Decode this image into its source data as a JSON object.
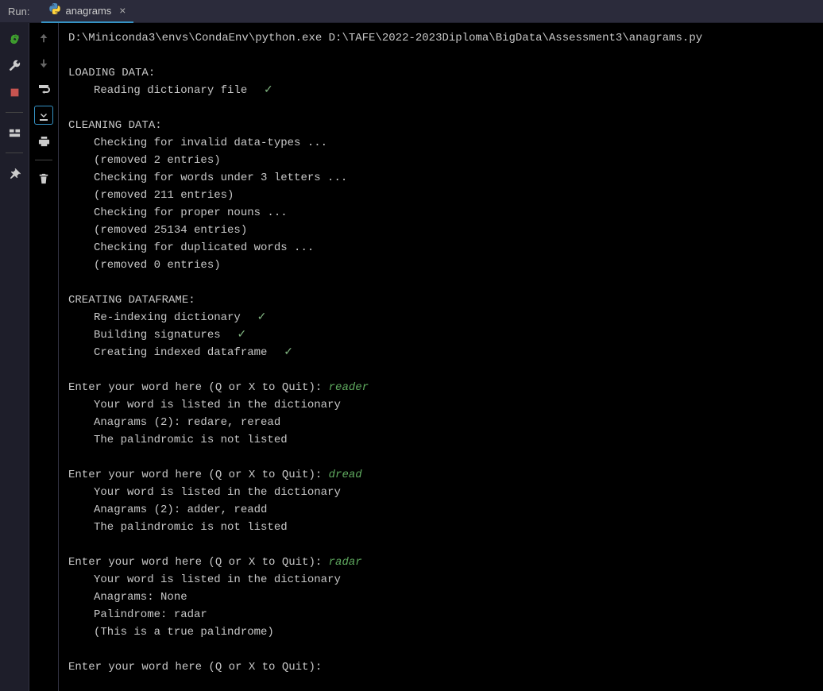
{
  "header": {
    "label": "Run:",
    "tab_name": "anagrams",
    "tab_close": "×"
  },
  "console": {
    "path": "D:\\Miniconda3\\envs\\CondaEnv\\python.exe D:\\TAFE\\2022-2023Diploma\\BigData\\Assessment3\\anagrams.py",
    "sections": [
      {
        "title": "LOADING DATA:",
        "lines": [
          {
            "text": "Reading dictionary file",
            "check": true
          }
        ]
      },
      {
        "title": "CLEANING DATA:",
        "lines": [
          {
            "text": "Checking for invalid data-types ..."
          },
          {
            "text": "(removed 2 entries)"
          },
          {
            "text": "Checking for words under 3 letters ..."
          },
          {
            "text": "(removed 211 entries)"
          },
          {
            "text": "Checking for proper nouns ..."
          },
          {
            "text": "(removed 25134 entries)"
          },
          {
            "text": "Checking for duplicated words ..."
          },
          {
            "text": "(removed 0 entries)"
          }
        ]
      },
      {
        "title": "CREATING DATAFRAME:",
        "lines": [
          {
            "text": "Re-indexing dictionary",
            "check": true
          },
          {
            "text": "Building signatures",
            "check": true
          },
          {
            "text": "Creating indexed dataframe",
            "check": true
          }
        ]
      }
    ],
    "interactions": [
      {
        "prompt": "Enter your word here (Q or X to Quit): ",
        "input": "reader",
        "responses": [
          "Your word is listed in the dictionary",
          "Anagrams (2): redare, reread",
          "The palindromic is not listed"
        ]
      },
      {
        "prompt": "Enter your word here (Q or X to Quit): ",
        "input": "dread",
        "responses": [
          "Your word is listed in the dictionary",
          "Anagrams (2): adder, readd",
          "The palindromic is not listed"
        ]
      },
      {
        "prompt": "Enter your word here (Q or X to Quit): ",
        "input": "radar",
        "responses": [
          "Your word is listed in the dictionary",
          "Anagrams: None",
          "Palindrome: radar",
          "(This is a true palindrome)"
        ]
      },
      {
        "prompt": "Enter your word here (Q or X to Quit): ",
        "input": "",
        "responses": []
      }
    ]
  }
}
